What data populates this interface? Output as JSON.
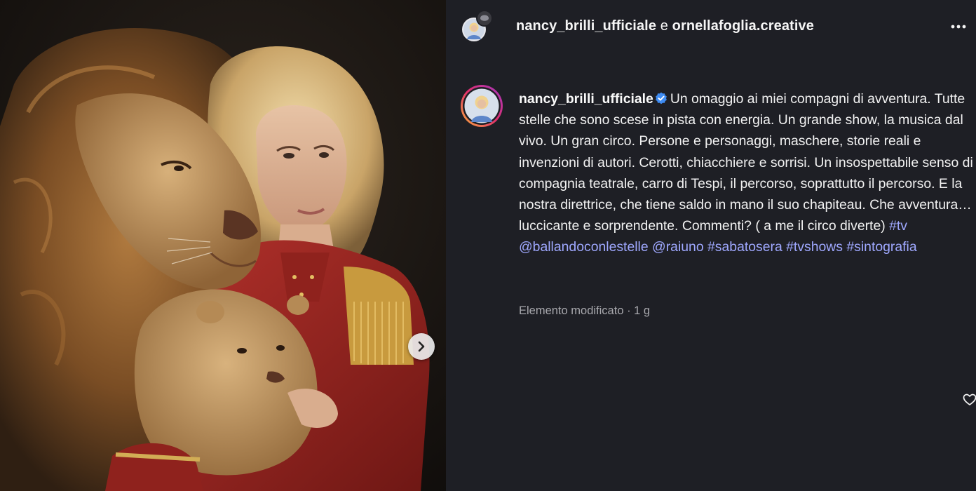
{
  "post": {
    "author": "nancy_brilli_ufficiale",
    "header_separator": "e",
    "collaborator": "ornellafoglia.creative",
    "caption": {
      "username": "nancy_brilli_ufficiale",
      "text": "Un omaggio ai miei compagni di avventura. Tutte stelle che sono scese in pista con energia. Un grande show, la musica dal vivo. Un gran circo. Persone e personaggi, maschere, storie reali e invenzioni di autori. Cerotti, chiacchiere e sorrisi. Un insospettabile senso di compagnia teatrale, carro di Tespi, il percorso, soprattutto il percorso. E la nostra direttrice, che tiene saldo in mano il suo chapiteau. Che avventura… luccicante e sorprendente. Commenti? ( a me il circo diverte)",
      "tags": [
        "#tv",
        "@ballandoconlestelle",
        "@raiuno",
        "#sabatosera",
        "#tvshows",
        "#sintografia"
      ]
    },
    "meta": "Elemento modificato · 1 g"
  },
  "icons": {
    "more": "more-horizontal-icon",
    "carousel_next": "chevron-right-icon",
    "verified": "verified-badge-icon",
    "like": "heart-icon"
  },
  "colors": {
    "panel_bg": "#1e1f25",
    "link": "#9fa8ff",
    "verified": "#3f8cf3",
    "muted": "#a8a8ad"
  }
}
